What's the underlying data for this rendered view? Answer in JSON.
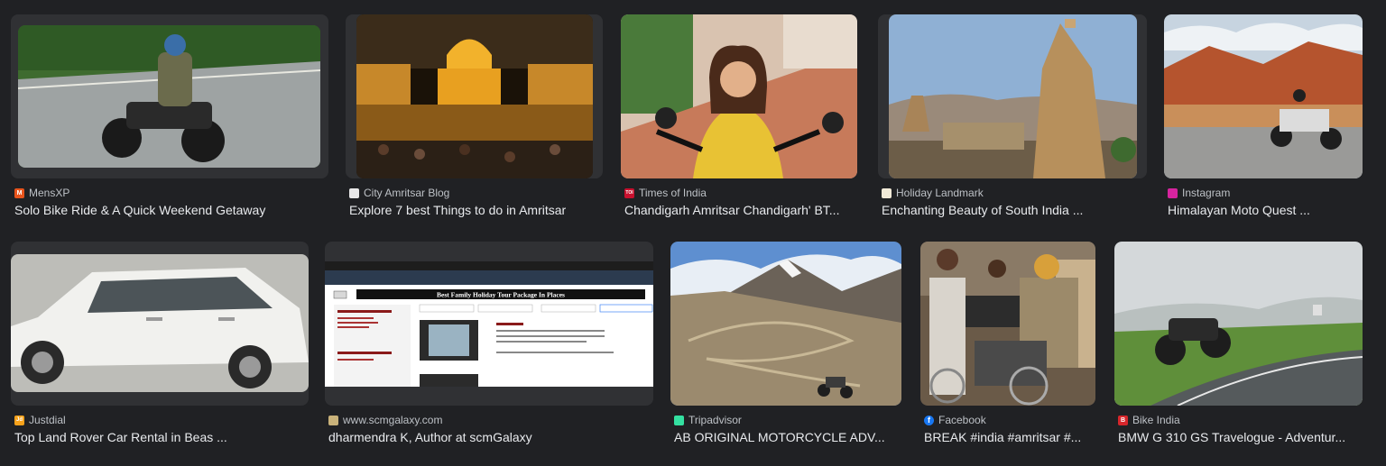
{
  "results": [
    {
      "source": "MensXP",
      "title": "Solo Bike Ride & A Quick Weekend Getaway",
      "favicon": "mensxp-icon",
      "fav_color": "#e8541c",
      "fav_glyph": "M"
    },
    {
      "source": "City Amritsar Blog",
      "title": "Explore 7 best Things to do in Amritsar",
      "favicon": "city-amritsar-blog-icon",
      "fav_color": "#e8e8e8",
      "fav_glyph": ""
    },
    {
      "source": "Times of India",
      "title": "Chandigarh Amritsar Chandigarh' BT...",
      "favicon": "times-of-india-icon",
      "fav_color": "#c8102e",
      "fav_glyph": "TOI"
    },
    {
      "source": "Holiday Landmark",
      "title": "Enchanting Beauty of South India ...",
      "favicon": "holiday-landmark-icon",
      "fav_color": "#f1ead8",
      "fav_glyph": ""
    },
    {
      "source": "Instagram",
      "title": "Himalayan Moto Quest ...",
      "favicon": "instagram-icon",
      "fav_color": "#d6249f",
      "fav_glyph": ""
    },
    {
      "source": "Justdial",
      "title": "Top Land Rover Car Rental in Beas ...",
      "favicon": "justdial-icon",
      "fav_color": "#f7a21b",
      "fav_glyph": "Jd"
    },
    {
      "source": "www.scmgalaxy.com",
      "title": "dharmendra K, Author at scmGalaxy",
      "favicon": "scmgalaxy-icon",
      "fav_color": "#c9b27a",
      "fav_glyph": ""
    },
    {
      "source": "Tripadvisor",
      "title": "AB ORIGINAL MOTORCYCLE ADV...",
      "favicon": "tripadvisor-icon",
      "fav_color": "#34e0a1",
      "fav_glyph": ""
    },
    {
      "source": "Facebook",
      "title": "BREAK #india #amritsar #...",
      "favicon": "facebook-icon",
      "fav_color": "#1877f2",
      "fav_glyph": "f"
    },
    {
      "source": "Bike India",
      "title": "BMW G 310 GS Travelogue - Adventur...",
      "favicon": "bike-india-icon",
      "fav_color": "#d7262b",
      "fav_glyph": "B"
    }
  ],
  "screenshot_texts": {
    "banner": "Best Family Holiday Tour Package In Places"
  }
}
